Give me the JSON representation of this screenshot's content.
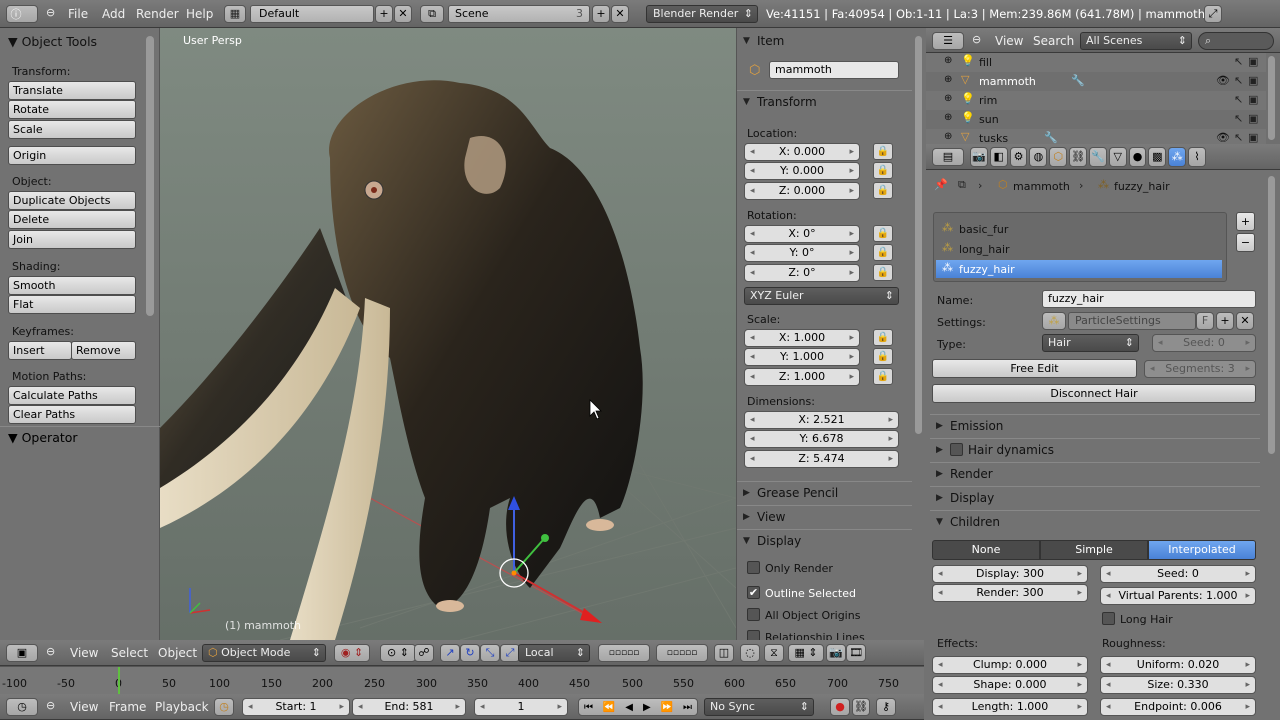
{
  "topbar": {
    "menus": [
      "File",
      "Add",
      "Render",
      "Help"
    ],
    "layout": "Default",
    "scene": "Scene",
    "scene_users": "3",
    "engine": "Blender Render",
    "stats": "Ve:41151 | Fa:40954 | Ob:1-11 | La:3 | Mem:239.86M (641.78M) | mammoth"
  },
  "tools": {
    "title": "Object Tools",
    "transform_label": "Transform:",
    "translate": "Translate",
    "rotate": "Rotate",
    "scale": "Scale",
    "origin": "Origin",
    "object_label": "Object:",
    "duplicate": "Duplicate Objects",
    "delete": "Delete",
    "join": "Join",
    "shading_label": "Shading:",
    "smooth": "Smooth",
    "flat": "Flat",
    "keyframes_label": "Keyframes:",
    "insert": "Insert",
    "remove": "Remove",
    "motion_label": "Motion Paths:",
    "calc_paths": "Calculate Paths",
    "clear_paths": "Clear Paths",
    "operator": "Operator"
  },
  "viewport": {
    "label": "User Persp",
    "object_label": "(1) mammoth"
  },
  "npanel": {
    "item_header": "Item",
    "item_name": "mammoth",
    "transform_header": "Transform",
    "location_label": "Location:",
    "loc_x": "X: 0.000",
    "loc_y": "Y: 0.000",
    "loc_z": "Z: 0.000",
    "rotation_label": "Rotation:",
    "rot_x": "X: 0°",
    "rot_y": "Y: 0°",
    "rot_z": "Z: 0°",
    "rot_mode": "XYZ Euler",
    "scale_label": "Scale:",
    "sc_x": "X: 1.000",
    "sc_y": "Y: 1.000",
    "sc_z": "Z: 1.000",
    "dim_label": "Dimensions:",
    "dim_x": "X: 2.521",
    "dim_y": "Y: 6.678",
    "dim_z": "Z: 5.474",
    "grease": "Grease Pencil",
    "view": "View",
    "display": "Display",
    "only_render": "Only Render",
    "outline": "Outline Selected",
    "all_origins": "All Object Origins",
    "rel_lines": "Relationship Lines"
  },
  "outliner": {
    "view": "View",
    "search": "Search",
    "scenes": "All Scenes",
    "items": [
      {
        "name": "fill",
        "type": "lamp"
      },
      {
        "name": "mammoth",
        "type": "mesh"
      },
      {
        "name": "rim",
        "type": "lamp"
      },
      {
        "name": "sun",
        "type": "lamp"
      },
      {
        "name": "tusks",
        "type": "mesh"
      }
    ]
  },
  "props": {
    "breadcrumb_obj": "mammoth",
    "breadcrumb_psys": "fuzzy_hair",
    "systems": [
      "basic_fur",
      "long_hair",
      "fuzzy_hair"
    ],
    "name_label": "Name:",
    "name_value": "fuzzy_hair",
    "settings_label": "Settings:",
    "settings_value": "ParticleSettings",
    "settings_flag": "F",
    "type_label": "Type:",
    "type_value": "Hair",
    "seed": "Seed: 0",
    "free_edit": "Free Edit",
    "segments": "Segments: 3",
    "disconnect": "Disconnect Hair",
    "emission": "Emission",
    "hair_dynamics": "Hair dynamics",
    "render": "Render",
    "display": "Display",
    "children": "Children",
    "child_none": "None",
    "child_simple": "Simple",
    "child_interp": "Interpolated",
    "c_display": "Display: 300",
    "c_render": "Render: 300",
    "c_seed": "Seed: 0",
    "c_virtual": "Virtual Parents: 1.000",
    "long_hair": "Long Hair",
    "effects_label": "Effects:",
    "roughness_label": "Roughness:",
    "clump": "Clump: 0.000",
    "shape": "Shape: 0.000",
    "length": "Length: 1.000",
    "uniform": "Uniform: 0.020",
    "size": "Size: 0.330",
    "endpoint": "Endpoint: 0.006"
  },
  "view3d_header": {
    "view": "View",
    "select": "Select",
    "object": "Object",
    "mode": "Object Mode",
    "orientation": "Local"
  },
  "timeline": {
    "ticks": [
      "-100",
      "-50",
      "0",
      "50",
      "100",
      "150",
      "200",
      "250",
      "300",
      "350",
      "400",
      "450",
      "500",
      "550",
      "600",
      "650",
      "700",
      "750"
    ],
    "view": "View",
    "frame": "Frame",
    "playback": "Playback",
    "start": "Start: 1",
    "end": "End: 581",
    "current": "1",
    "sync": "No Sync"
  }
}
